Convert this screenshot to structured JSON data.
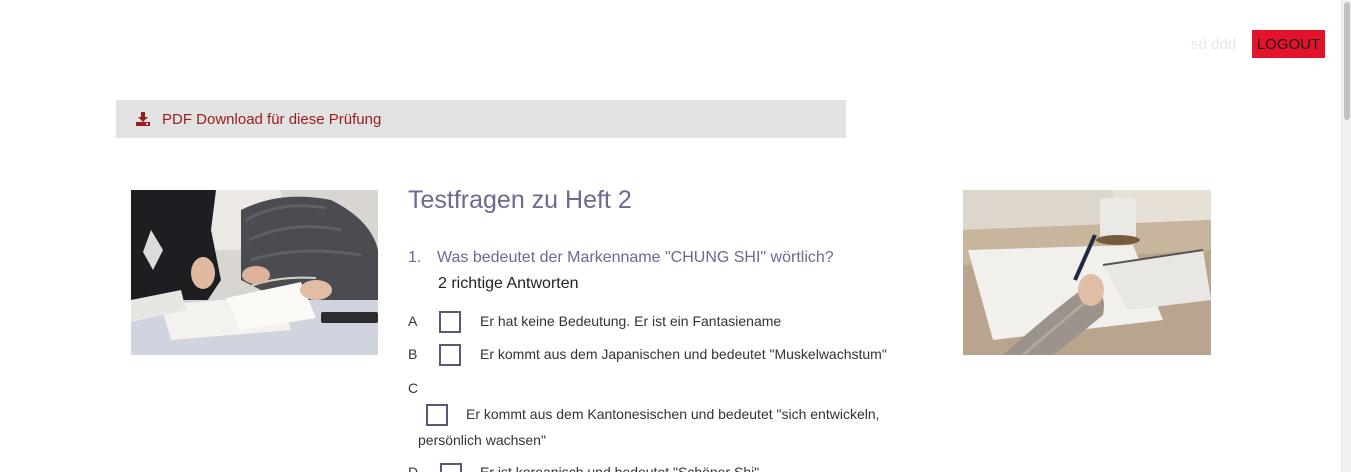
{
  "header": {
    "user_name": "sd ddd",
    "logout_label": "LOGOUT"
  },
  "download": {
    "label": "PDF Download für diese Prüfung",
    "icon": "download-icon"
  },
  "quiz": {
    "title": "Testfragen zu Heft 2",
    "question": {
      "number": "1.",
      "text": "Was bedeutet der Markenname \"CHUNG SHI\" wörtlich?",
      "hint": "2 richtige Antworten",
      "options": [
        {
          "letter": "A",
          "text": "Er hat keine Bedeutung. Er ist ein Fantasiename"
        },
        {
          "letter": "B",
          "text": "Er kommt aus dem Japanischen und bedeutet \"Muskelwachstum\""
        },
        {
          "letter": "C",
          "text_line1": "Er kommt aus dem Kantonesischen und bedeutet \"sich entwickeln,",
          "text_line2": "persönlich wachsen\""
        },
        {
          "letter": "D",
          "text": "Er ist koreanisch und bedeutet \"Schöner Shi\""
        }
      ]
    }
  },
  "colors": {
    "accent": "#6e6892",
    "logout_bg": "#e4132c",
    "download_text": "#9b1c1c",
    "download_bg": "#e2e2e2"
  }
}
